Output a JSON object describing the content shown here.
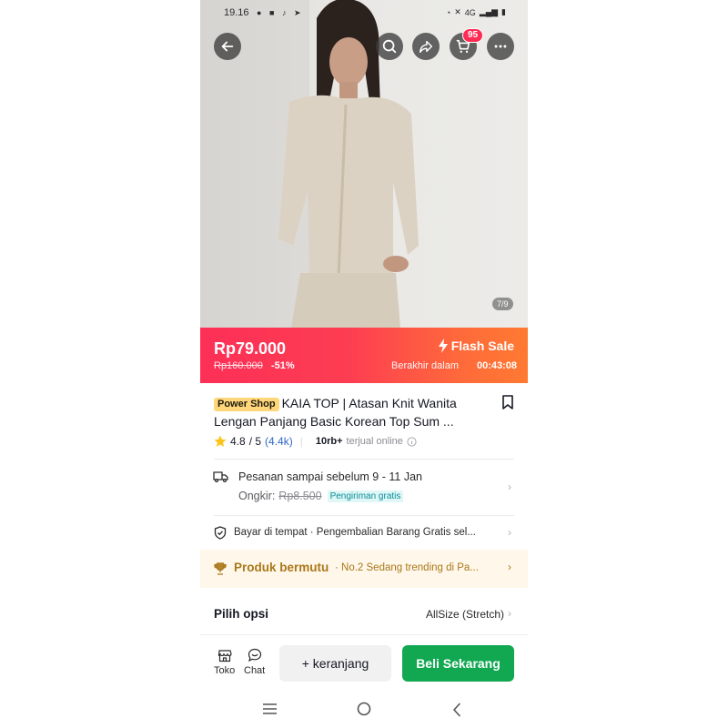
{
  "status_bar": {
    "time": "19.16",
    "network": "4G"
  },
  "top_actions": {
    "cart_count": "95"
  },
  "gallery": {
    "counter": "7/9"
  },
  "flash_sale": {
    "price": "Rp79.000",
    "original_price": "Rp160.000",
    "discount": "-51%",
    "label": "Flash Sale",
    "ends_label": "Berakhir dalam",
    "countdown": "00:43:08"
  },
  "product": {
    "badge": "Power Shop",
    "title": "KAIA TOP | Atasan Knit Wanita Lengan Panjang Basic Korean Top Sum ...",
    "rating": "4.8",
    "rating_max": "/ 5",
    "rating_count": "(4.4k)",
    "sold_count": "10rb+",
    "sold_label": "terjual online"
  },
  "shipping": {
    "title": "Pesanan sampai sebelum 9 - 11 Jan",
    "fee_label": "Ongkir:",
    "fee": "Rp8.500",
    "free_label": "Pengiriman gratis"
  },
  "services": {
    "text": "Bayar di tempat · Pengembalian Barang Gratis sel..."
  },
  "trending": {
    "label": "Produk bermutu",
    "text": "· No.2 Sedang trending di Pa..."
  },
  "options": {
    "label": "Pilih opsi",
    "value": "AllSize (Stretch)"
  },
  "bottom_bar": {
    "shop_label": "Toko",
    "chat_label": "Chat",
    "add_to_cart": "+ keranjang",
    "buy_now": "Beli Sekarang"
  },
  "colors": {
    "flash_start": "#fd2f57",
    "flash_end": "#ff7a32",
    "buy_button": "#11a851",
    "badge": "#fe2c55",
    "trending_text": "#a9781a"
  },
  "icons": [
    "back-arrow-icon",
    "search-icon",
    "share-icon",
    "cart-icon",
    "more-icon",
    "lightning-icon",
    "bookmark-icon",
    "star-icon",
    "info-icon",
    "truck-icon",
    "shield-icon",
    "trophy-icon",
    "chevron-right-icon",
    "store-icon",
    "chat-icon"
  ]
}
